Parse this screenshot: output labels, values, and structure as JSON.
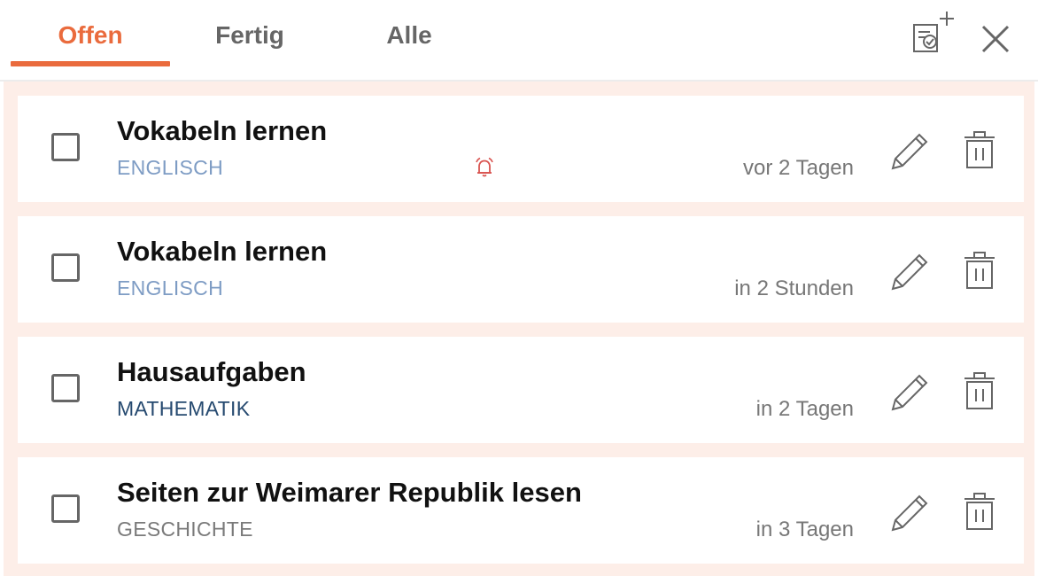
{
  "tabs": [
    {
      "label": "Offen",
      "active": true
    },
    {
      "label": "Fertig",
      "active": false
    },
    {
      "label": "Alle",
      "active": false
    }
  ],
  "header_icons": [
    "add-task-icon",
    "close-icon"
  ],
  "colors": {
    "accent": "#ea6b3d",
    "list_background": "#fdeee8",
    "alarm": "#d9534f"
  },
  "tasks": [
    {
      "title": "Vokabeln lernen",
      "subject": "ENGLISCH",
      "subject_color": "#7e9cc4",
      "due": "vor 2 Tagen",
      "alarm": true,
      "done": false
    },
    {
      "title": "Vokabeln lernen",
      "subject": "ENGLISCH",
      "subject_color": "#7e9cc4",
      "due": "in 2 Stunden",
      "alarm": false,
      "done": false
    },
    {
      "title": "Hausaufgaben",
      "subject": "MATHEMATIK",
      "subject_color": "#264a70",
      "due": "in 2 Tagen",
      "alarm": false,
      "done": false
    },
    {
      "title": "Seiten zur Weimarer Republik lesen",
      "subject": "GESCHICHTE",
      "subject_color": "#7a7a7a",
      "due": "in 3 Tagen",
      "alarm": false,
      "done": false
    }
  ]
}
